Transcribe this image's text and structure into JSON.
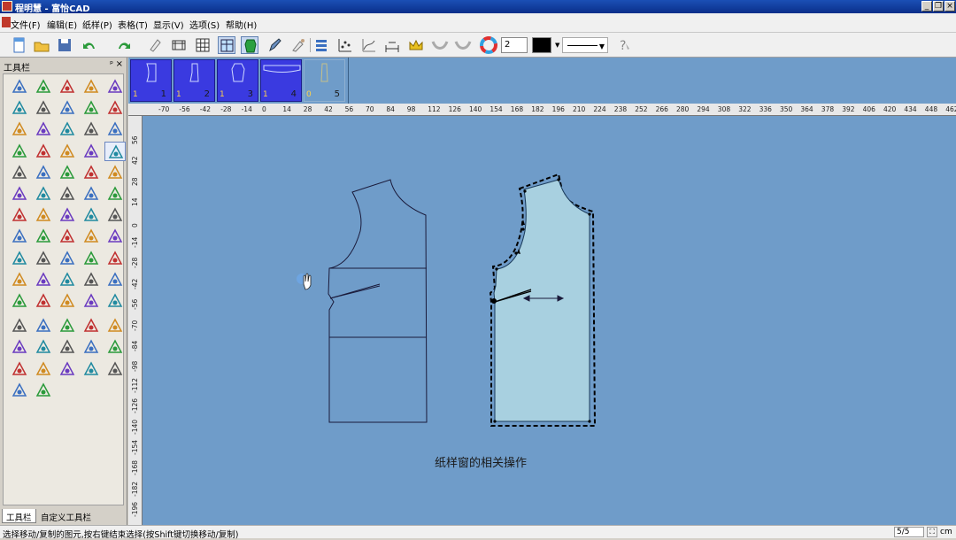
{
  "titlebar": {
    "title": "程明慧 - 富怡CAD"
  },
  "menu": [
    "文件(F)",
    "编辑(E)",
    "纸样(P)",
    "表格(T)",
    "显示(V)",
    "选项(S)",
    "帮助(H)"
  ],
  "toolbar": {
    "line_width": "2",
    "color": "#000000"
  },
  "panel": {
    "title": "工具栏",
    "tab_toolbar": "工具栏",
    "tab_custom": "自定义工具栏"
  },
  "thumbnails": [
    {
      "count": "1",
      "number": "1",
      "active": true
    },
    {
      "count": "1",
      "number": "2",
      "active": true
    },
    {
      "count": "1",
      "number": "3",
      "active": true
    },
    {
      "count": "1",
      "number": "4",
      "active": true
    },
    {
      "count": "0",
      "number": "5",
      "active": false
    }
  ],
  "ruler": {
    "top": [
      "-70",
      "-56",
      "-42",
      "-28",
      "-14",
      "0",
      "14",
      "28",
      "42",
      "56",
      "70",
      "84",
      "98",
      "112",
      "126",
      "140",
      "154",
      "168",
      "182",
      "196",
      "210",
      "224",
      "238",
      "252",
      "266",
      "280",
      "294",
      "308",
      "322",
      "336",
      "350",
      "364",
      "378",
      "392",
      "406",
      "420",
      "434",
      "448",
      "462"
    ],
    "left": [
      "56",
      "42",
      "28",
      "14",
      "0",
      "-14",
      "-28",
      "-42",
      "-56",
      "-70",
      "-84",
      "-98",
      "-112",
      "-126",
      "-140",
      "-154",
      "-168",
      "-182",
      "-196"
    ]
  },
  "canvas": {
    "caption": "纸样窗的相关操作"
  },
  "status": {
    "message": "选择移动/复制的图元,按右键结束选择(按Shift键切换移动/复制)",
    "pages": "5/5",
    "unit": "cm"
  },
  "icons": [
    "new-icon",
    "open-icon",
    "save-icon",
    "undo-icon",
    "redo-icon",
    "eraser-icon",
    "ruler-icon",
    "grid-icon",
    "window-icon",
    "pattern-icon",
    "pen-icon",
    "brush-icon",
    "arrange-icon",
    "scatter-icon",
    "curve-icon",
    "measure-icon",
    "crown-icon",
    "seam-icon",
    "color-wheel-icon",
    "help-icon"
  ]
}
